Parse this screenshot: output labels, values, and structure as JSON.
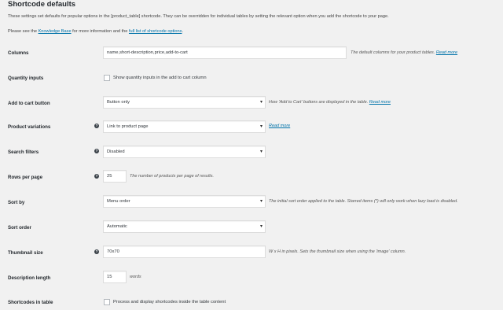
{
  "heading": "Shortcode defaults",
  "intro": {
    "line1": "These settings set defaults for popular options in the [product_table] shortcode. They can be overridden for individual tables by setting the relevant option when you add the shortcode to your page.",
    "line2_pre": "Please see the",
    "line2_link1": "Knowledge Base",
    "line2_mid": "for more information and the",
    "line2_link2": "full list of shortcode options",
    "line2_post": "."
  },
  "rows": {
    "columns": {
      "label": "Columns",
      "value": "name,short-description,price,add-to-cart",
      "desc": "The default columns for your product tables.",
      "link": "Read more"
    },
    "quantity": {
      "label": "Quantity inputs",
      "checkbox_label": "Show quantity inputs in the add to cart column"
    },
    "add_to_cart": {
      "label": "Add to cart button",
      "value": "Button only",
      "desc": "How 'Add to Cart' buttons are displayed in the table.",
      "link": "Read more"
    },
    "variations": {
      "label": "Product variations",
      "value": "Link to product page",
      "link": "Read more"
    },
    "filters": {
      "label": "Search filters",
      "value": "Disabled"
    },
    "rows_per_page": {
      "label": "Rows per page",
      "value": "25",
      "desc": "The number of products per page of results."
    },
    "sort_by": {
      "label": "Sort by",
      "value": "Menu order",
      "desc": "The initial sort order applied to the table. Starred items (*) will only work when lazy load is disabled."
    },
    "sort_order": {
      "label": "Sort order",
      "value": "Automatic"
    },
    "thumb": {
      "label": "Thumbnail size",
      "value": "70x70",
      "desc": "W x H in pixels. Sets the thumbnail size when using the 'image' column."
    },
    "desc_length": {
      "label": "Description length",
      "value": "15",
      "desc": "words"
    },
    "shortcodes": {
      "label": "Shortcodes in table",
      "checkbox_label": "Process and display shortcodes inside the table content"
    }
  },
  "icons": {
    "help": "?"
  },
  "colors": {
    "link": "#0073aa",
    "background": "#f1f1f1"
  }
}
